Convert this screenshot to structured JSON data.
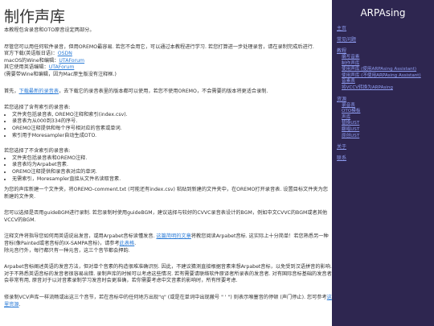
{
  "title": "制作声库",
  "intro": "本教程包含录音和OTO原音设定两部分。",
  "tools_para": "尽管您可以用任何软件录音，但用OREMO最容易. 若您不会用它，可以通过本教程进行学习. 若您打算进一步处理录音，请在录制完成后进行.",
  "tools": [
    {
      "label": "官方下载(英语版日语)：",
      "link": "OSDN"
    },
    {
      "label": "macOS的Wine和编辑：",
      "link": "UTAForum"
    },
    {
      "label": "其它使用英语编辑：",
      "link": "UTAForum"
    }
  ],
  "tools_note": "(需要带Wine和编辑，因为Mac原生版没有注释框.)",
  "first_para": {
    "before": "首先，",
    "link": "下载最新的录音表",
    "after": "，去下载它的录音表里的版本都可以使用，若您不使用OREMO，不会需要的版本将更适合录制."
  },
  "ifuse_title": "若您选择了含有索引的录音表:",
  "ifuse_items": [
    "文件夹包括录音表, OREMO注释和索引(index.csv).",
    "录音表为从000到334的序号.",
    "OREMO注释提供和每个序号相对应的音素或单词.",
    "索引用于Moresampler自动生成OTO."
  ],
  "ifnot_title": "若您选择了不含索引的录音表:",
  "ifnot_items": [
    "文件夹包括录音表和OREMO注释.",
    "录音表均为Arpabet音素.",
    "OREMO注释提供和录音表对应的单词.",
    "无需索引，Moresampler直接从文件名读取音素."
  ],
  "para_reclist": "为您的声库新建一个文件夹，将OREMO-comment.txt (可能还有index.csv) 粘贴到新建的文件夹中，在OREMO打开录音表. 设置目标文件夹为您新建的文件夹.",
  "para_bgm": "您可以选择是否用guideBGM进行录制. 若您录制时使用guideBGM，建议选择与较好的CVVC录音表设计的BGM，例如中文CVVC的BGM或者其他VCCV的BGM.",
  "para_notes": {
    "before": "注释文件将指导您如何用英语说出发音，或用Arpabet音标读懂发音. ",
    "link1": "这篇简明的文章",
    "mid": "将教您阅读Arpabet音标. 这实际上十分简单！若您熟悉另一种音标(像Painted或者音标的IX-SAMPA音标)，请参考",
    "link2": "此表格",
    "after": "."
  },
  "para_notes2": "除元音行外，每行都只有一种元音，这三个音节都会押韵.",
  "para_arpabet": "Arpabet音标阐述英语的发音方法，但对单个音素的构造很难准确识别. 因此，不建议猜测直接根据音素来想Arpabet音标，以免受到汉语拼音的影响. 对于不熟悉英语音标的发音者很容易出错. 录制声库的时候可以考虑这些情况. 若有需要请联络软件原译者所录表的发音者. 对有国际音标基础的发音者会非常有用, 原音对于以对音素录制学习发音时会更准确，若你需要考虑中文音素的影响时，所有所要考虑.",
  "para_cmd": {
    "before": "修录制VCV声库一样流畅或出这三个音节，若在音标中的任何地方出现\"q\" (或是在单词中出现撇号 \" ' \") 则表示喉塞音的停顿 (声门停止). 您可参考",
    "link": "这里资源",
    "after": "."
  },
  "sidebar": {
    "brand": "ARPAsing",
    "items": [
      {
        "label": "主页",
        "level": 0
      },
      {
        "label": "常见问题",
        "level": 0
      },
      {
        "label": "教程",
        "level": 0
      },
      {
        "label": "编写音素",
        "level": 1
      },
      {
        "label": "制作声库",
        "level": 1
      },
      {
        "label": "使用声库 (使用ARPAsing Assistant)",
        "level": 1
      },
      {
        "label": "使用声库 (不使用ARPAsing Assistant)",
        "level": 1
      },
      {
        "label": "音素表",
        "level": 1
      },
      {
        "label": "将VCCV转换为ARPAsing",
        "level": 1
      },
      {
        "label": "资源",
        "level": 0
      },
      {
        "label": "录音表",
        "level": 1
      },
      {
        "label": "OTO模板",
        "level": 1
      },
      {
        "label": "声库",
        "level": 1
      },
      {
        "label": "替换UST",
        "level": 1
      },
      {
        "label": "翻唱UST",
        "level": 1
      },
      {
        "label": "原创UST",
        "level": 1
      },
      {
        "label": "关于",
        "level": 0
      },
      {
        "label": "联系",
        "level": 0
      }
    ]
  }
}
